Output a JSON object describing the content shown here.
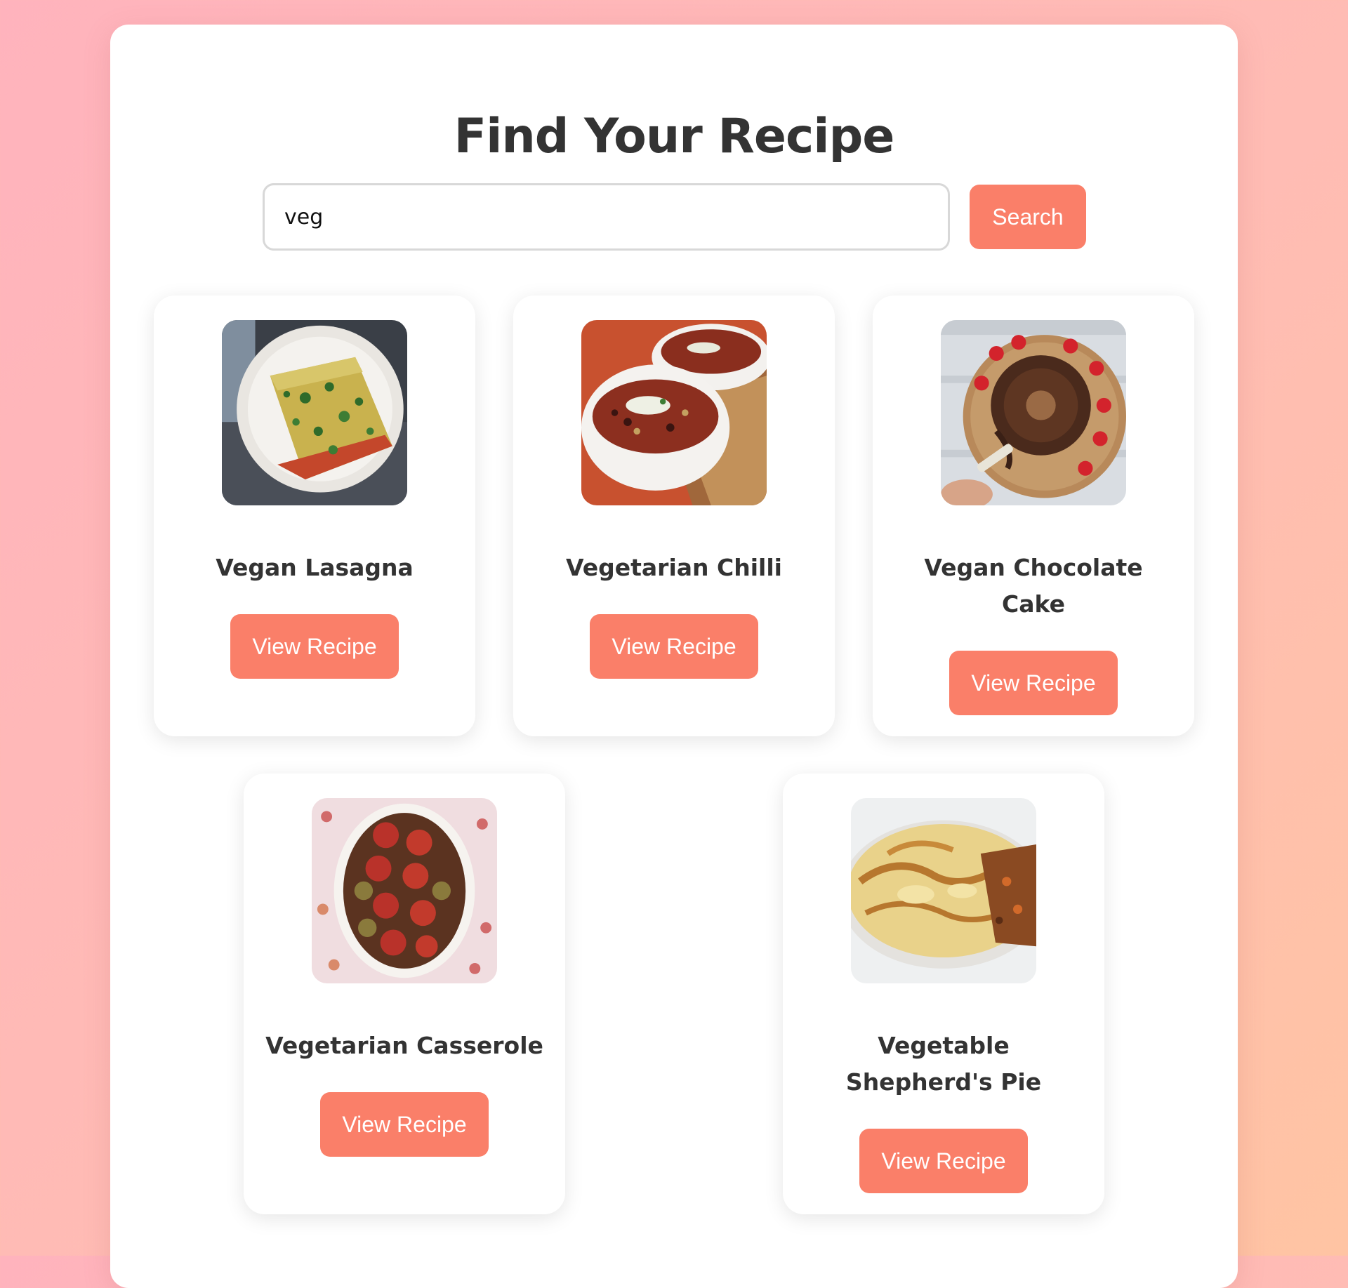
{
  "page": {
    "title": "Find Your Recipe"
  },
  "search": {
    "value": "veg",
    "button_label": "Search"
  },
  "recipes": [
    {
      "title": "Vegan Lasagna",
      "button_label": "View Recipe",
      "image": "vegan-lasagna-photo"
    },
    {
      "title": "Vegetarian Chilli",
      "button_label": "View Recipe",
      "image": "vegetarian-chilli-photo"
    },
    {
      "title": "Vegan Chocolate Cake",
      "button_label": "View Recipe",
      "image": "vegan-chocolate-cake-photo"
    },
    {
      "title": "Vegetarian Casserole",
      "button_label": "View Recipe",
      "image": "vegetarian-casserole-photo"
    },
    {
      "title": "Vegetable Shepherd's Pie",
      "button_label": "View Recipe",
      "image": "vegetable-shepherds-pie-photo"
    }
  ],
  "colors": {
    "accent": "#fa7f69",
    "background_start": "#ffb3bd",
    "background_end": "#ffc4a3",
    "heading_text": "#333333"
  }
}
